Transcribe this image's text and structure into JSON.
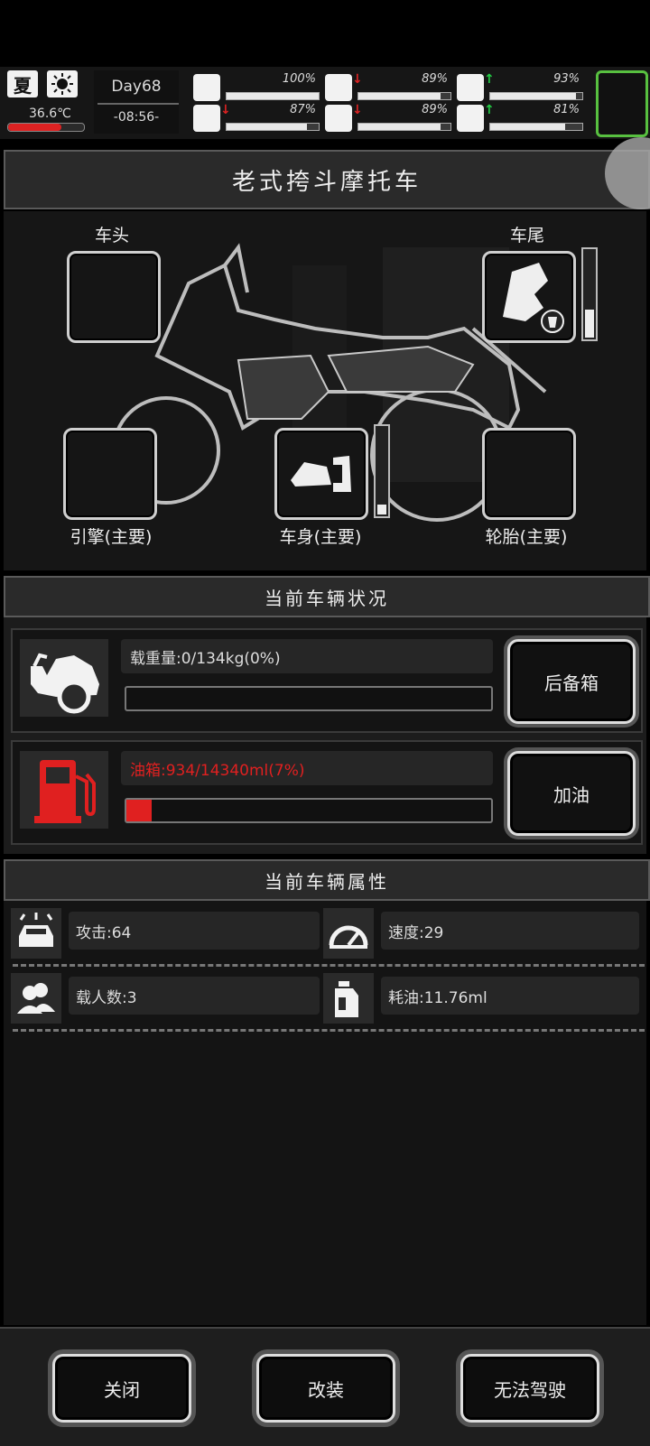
{
  "hud": {
    "season": "夏",
    "temperature": "36.6℃",
    "day": "Day68",
    "time": "-08:56-",
    "stats": [
      {
        "name": "health-icon",
        "value": "100%",
        "level": 1.0,
        "arrow": ""
      },
      {
        "name": "stomach-icon",
        "value": "89%",
        "level": 0.89,
        "arrow": "down"
      },
      {
        "name": "mood-icon",
        "value": "93%",
        "level": 0.93,
        "arrow": "up"
      },
      {
        "name": "stamina-icon",
        "value": "87%",
        "level": 0.87,
        "arrow": "down"
      },
      {
        "name": "water-icon",
        "value": "89%",
        "level": 0.89,
        "arrow": "down"
      },
      {
        "name": "heart-icon",
        "value": "81%",
        "level": 0.81,
        "arrow": "up"
      }
    ]
  },
  "title": "老式挎斗摩托车",
  "slots": {
    "head": "车头",
    "tail": "车尾",
    "engine": "引擎(主要)",
    "body": "车身(主要)",
    "tire": "轮胎(主要)",
    "tail_level": 0.35,
    "body_level": 0.15
  },
  "status": {
    "header": "当前车辆状况",
    "load_label": "载重量:0/134kg(0%)",
    "load_level": 0.0,
    "trunk_button": "后备箱",
    "fuel_label": "油箱:934/14340ml(7%)",
    "fuel_level": 0.07,
    "refuel_button": "加油"
  },
  "attributes": {
    "header": "当前车辆属性",
    "attack": "攻击:64",
    "speed": "速度:29",
    "passengers": "载人数:3",
    "fuel_use": "耗油:11.76ml"
  },
  "buttons": {
    "close": "关闭",
    "modify": "改装",
    "drive": "无法驾驶"
  },
  "colors": {
    "fuel_red": "#e02020",
    "up_green": "#22cc44",
    "down_red": "#dd2222"
  }
}
